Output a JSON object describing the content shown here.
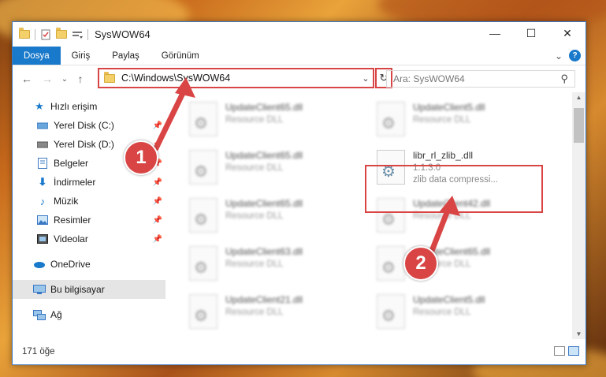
{
  "titlebar": {
    "title": "SysWOW64",
    "minimize_label": "—",
    "maximize_label": "☐",
    "close_label": "✕"
  },
  "ribbon": {
    "tabs": [
      {
        "label": "Dosya",
        "active": true
      },
      {
        "label": "Giriş"
      },
      {
        "label": "Paylaş"
      },
      {
        "label": "Görünüm"
      }
    ],
    "expand_label": "⌄",
    "help_label": "?"
  },
  "nav": {
    "back": "←",
    "forward": "→",
    "recent": "⌄",
    "up": "↑",
    "address": "C:\\Windows\\SysWOW64",
    "refresh": "↻",
    "search_placeholder": "Ara: SysWOW64"
  },
  "sidebar": {
    "quick_access": "Hızlı erişim",
    "items": [
      {
        "label": "Yerel Disk (C:)",
        "icon": "drive-icon",
        "pinned": true
      },
      {
        "label": "Yerel Disk (D:)",
        "icon": "drive-icon",
        "pinned": true
      },
      {
        "label": "Belgeler",
        "icon": "documents-icon",
        "pinned": true
      },
      {
        "label": "İndirmeler",
        "icon": "download-icon",
        "pinned": true
      },
      {
        "label": "Müzik",
        "icon": "music-icon",
        "pinned": true
      },
      {
        "label": "Resimler",
        "icon": "pictures-icon",
        "pinned": true
      },
      {
        "label": "Videolar",
        "icon": "video-icon",
        "pinned": true
      }
    ],
    "onedrive": "OneDrive",
    "this_pc": "Bu bilgisayar",
    "network": "Ağ"
  },
  "files": [
    {
      "name": "UpdateClient65.dll",
      "sub": "Resource DLL"
    },
    {
      "name": "UpdateClient5.dll",
      "sub": "Resource DLL"
    },
    {
      "name": "UpdateClient65.dll",
      "sub": "Resource DLL"
    },
    {
      "name": "libr_rl_zlib_.dll",
      "sub": "1.1.3.0",
      "sub2": "zlib data compressi...",
      "highlighted": true
    },
    {
      "name": "UpdateClient65.dll",
      "sub": "Resource DLL"
    },
    {
      "name": "UpdateClient42.dll",
      "sub": "Resource DLL"
    },
    {
      "name": "UpdateClient63.dll",
      "sub": "Resource DLL"
    },
    {
      "name": "UpdateClient65.dll",
      "sub": "Resource DLL"
    },
    {
      "name": "UpdateClient21.dll",
      "sub": "Resource DLL"
    },
    {
      "name": "UpdateClient5.dll",
      "sub": "Resource DLL"
    }
  ],
  "status": {
    "count": "171 öğe"
  },
  "annotations": {
    "step1": "1",
    "step2": "2",
    "color": "#d94545"
  }
}
